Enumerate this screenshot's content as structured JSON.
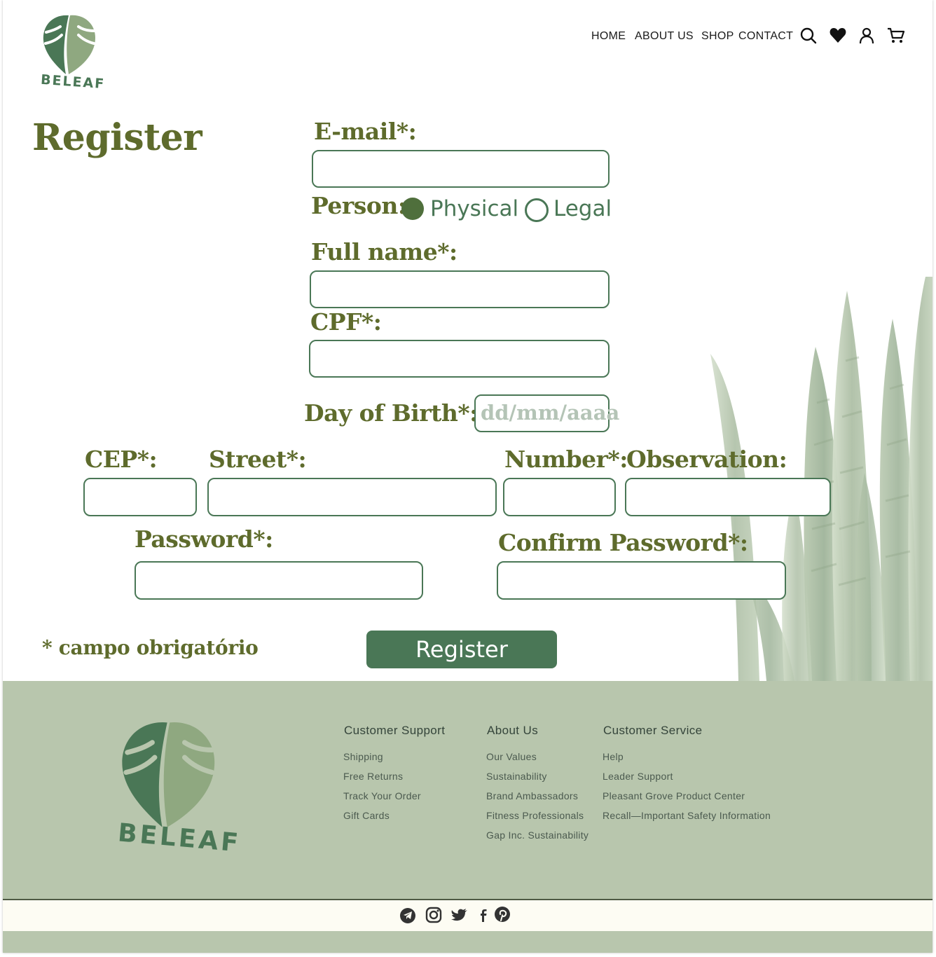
{
  "brand": {
    "name": "BELEAF"
  },
  "nav": {
    "items": [
      "HOME",
      "ABOUT US",
      "SHOP",
      "CONTACT"
    ],
    "icons": [
      "search-icon",
      "heart-icon",
      "user-icon",
      "cart-icon"
    ]
  },
  "form": {
    "title": "Register",
    "email_label": "E-mail*:",
    "person_label": "Person:",
    "person_options": [
      "Physical",
      "Legal"
    ],
    "person_selected": "Physical",
    "fullname_label": "Full name*:",
    "cpf_label": "CPF*:",
    "birth_label": "Day of Birth*:",
    "birth_placeholder": "dd/mm/aaaa",
    "cep_label": "CEP*:",
    "street_label": "Street*:",
    "number_label": "Number*:",
    "observation_label": "Observation:",
    "password_label": "Password*:",
    "confirm_label": "Confirm Password*:",
    "required_note": "* campo obrigatório",
    "submit_label": "Register"
  },
  "footer": {
    "columns": [
      {
        "title": "Customer Support",
        "items": [
          "Shipping",
          "Free Returns",
          "Track Your Order",
          "Gift Cards"
        ]
      },
      {
        "title": "About Us",
        "items": [
          "Our Values",
          "Sustainability",
          "Brand Ambassadors",
          "Fitness Professionals",
          "Gap Inc. Sustainability"
        ]
      },
      {
        "title": "Customer Service",
        "items": [
          "Help",
          "Leader Support",
          "Pleasant Grove Product Center",
          "Recall—Important Safety Information"
        ]
      }
    ],
    "social": [
      "telegram-icon",
      "instagram-icon",
      "twitter-icon",
      "facebook-icon",
      "pinterest-icon"
    ]
  },
  "colors": {
    "primary_green": "#4a7756",
    "olive_text": "#5e6b2c",
    "footer_bg": "#b8c6ad",
    "leaf_dark": "#4a7756",
    "leaf_light": "#8fa880"
  }
}
